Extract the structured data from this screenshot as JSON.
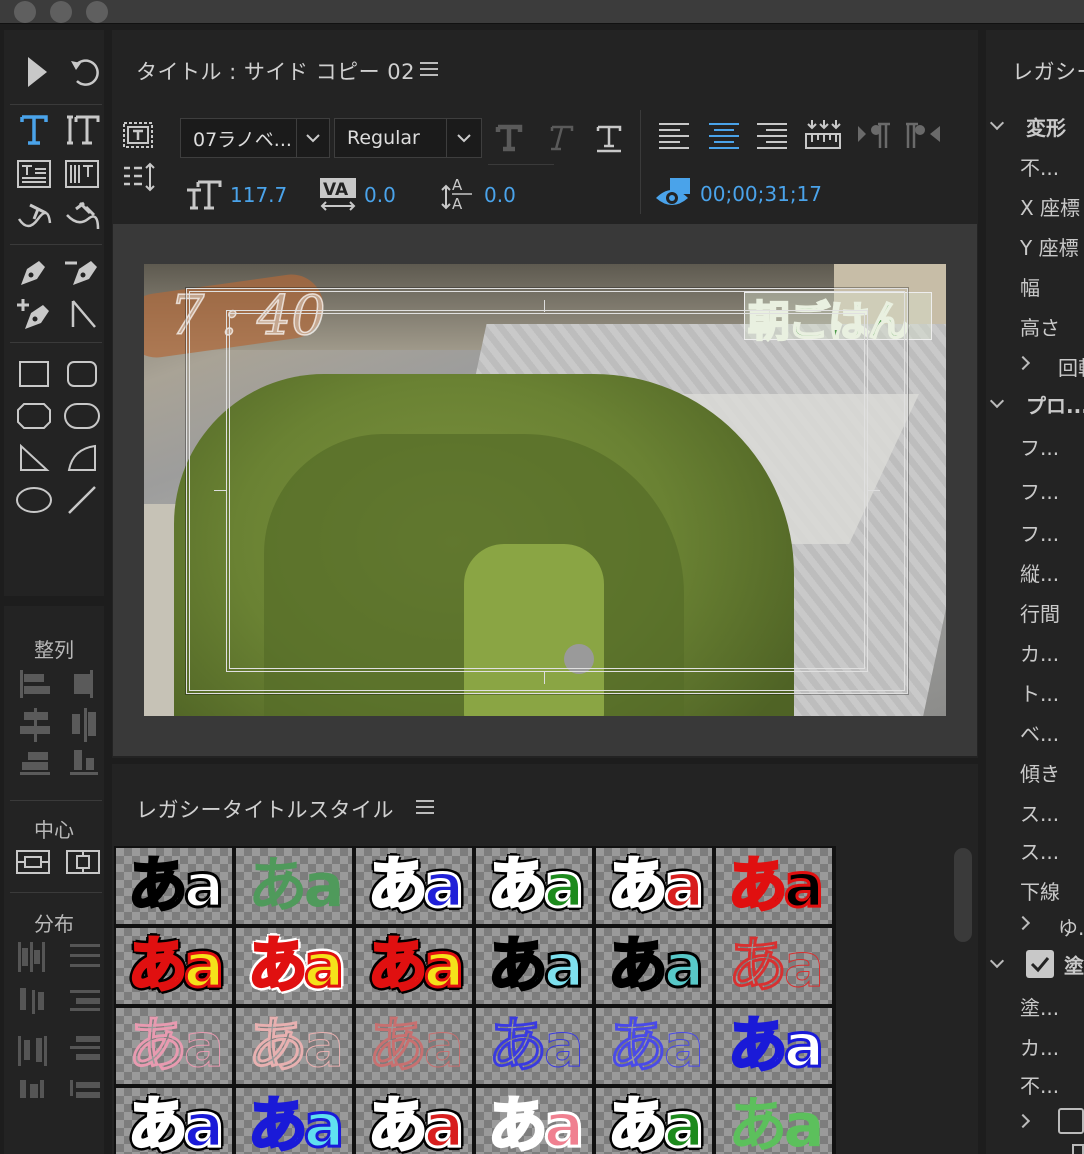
{
  "colors": {
    "accent": "#4aa3ea",
    "panel": "#232323",
    "background": "#1d1d1d"
  },
  "tools_panel": {
    "align_label": "整列",
    "center_label": "中心",
    "distribute_label": "分布",
    "tools": [
      "selection-tool",
      "rotate-tool",
      "type-tool",
      "vertical-type-tool",
      "area-type-tool",
      "vertical-area-type-tool",
      "path-type-tool",
      "vertical-path-type-tool",
      "pen-tool",
      "delete-anchor-tool",
      "add-anchor-tool",
      "convert-anchor-tool",
      "rectangle-tool",
      "rounded-rect-tool",
      "clipped-rect-tool",
      "rounded-corner-tool",
      "wedge-tool",
      "arc-tool",
      "ellipse-tool",
      "line-tool"
    ]
  },
  "title_panel": {
    "title": "タイトル : サイド コピー 02",
    "font_family": "07ラノベ...",
    "font_style": "Regular",
    "font_size": "117.7",
    "kerning": "0.0",
    "leading": "0.0",
    "timecode": "00;00;31;17"
  },
  "video": {
    "time_text": "7 : 40",
    "caption_text": "朝ごはん"
  },
  "styles_panel": {
    "title": "レガシータイトルスタイル",
    "swatches": [
      {
        "text": "あa",
        "fg": "#ffffff",
        "stroke": "#000000",
        "outer": "",
        "bg": "checker"
      },
      {
        "text": "あa",
        "fg": "#4f9a5b",
        "stroke": "",
        "outer": "",
        "bg": "checker"
      },
      {
        "text": "あa",
        "fg": "#2020d8",
        "stroke": "#ffffff",
        "outer": "#000000",
        "bg": "checker"
      },
      {
        "text": "あa",
        "fg": "#1c8a1c",
        "stroke": "#ffffff",
        "outer": "#000000",
        "bg": "checker"
      },
      {
        "text": "あa",
        "fg": "#d81e1e",
        "stroke": "#ffffff",
        "outer": "#000000",
        "bg": "checker"
      },
      {
        "text": "あa",
        "fg": "#000000",
        "stroke": "#e01010",
        "outer": "",
        "bg": "checker"
      },
      {
        "text": "あa",
        "fg": "#f5e21a",
        "stroke": "#e01010",
        "outer": "#000000",
        "bg": "checker"
      },
      {
        "text": "あa",
        "fg": "#f5e21a",
        "stroke": "#e01010",
        "outer": "#ffffff",
        "bg": "checker"
      },
      {
        "text": "あa",
        "fg": "#f5e21a",
        "stroke": "#e01010",
        "outer": "#000000",
        "bg": "checker"
      },
      {
        "text": "あa",
        "fg": "#7ee0ee",
        "stroke": "#000000",
        "outer": "",
        "bg": "checker"
      },
      {
        "text": "あa",
        "fg": "#58c8c8",
        "stroke": "#000000",
        "outer": "",
        "bg": "checker"
      },
      {
        "text": "あa",
        "fg": "transparent",
        "stroke": "#d83030",
        "outer": "",
        "bg": "checker"
      },
      {
        "text": "あa",
        "fg": "transparent",
        "stroke": "#e89ab0",
        "outer": "",
        "bg": "checker"
      },
      {
        "text": "あa",
        "fg": "transparent",
        "stroke": "#e8b0b0",
        "outer": "",
        "bg": "checker"
      },
      {
        "text": "あa",
        "fg": "transparent",
        "stroke": "#c87070",
        "outer": "",
        "bg": "checker"
      },
      {
        "text": "あa",
        "fg": "transparent",
        "stroke": "#3a3ae0",
        "outer": "",
        "bg": "checker"
      },
      {
        "text": "あa",
        "fg": "transparent",
        "stroke": "#4a4ae8",
        "outer": "",
        "bg": "checker"
      },
      {
        "text": "あa",
        "fg": "#ffffff",
        "stroke": "#1a1ad8",
        "outer": "",
        "bg": "checker"
      },
      {
        "text": "あa",
        "fg": "#1a1ad8",
        "stroke": "#ffffff",
        "outer": "#000000",
        "bg": "checker"
      },
      {
        "text": "あa",
        "fg": "#60e0f0",
        "stroke": "#1a1ad8",
        "outer": "",
        "bg": "checker"
      },
      {
        "text": "あa",
        "fg": "#d81e1e",
        "stroke": "#ffffff",
        "outer": "#000000",
        "bg": "checker"
      },
      {
        "text": "あa",
        "fg": "#f08090",
        "stroke": "#ffffff",
        "outer": "",
        "bg": "checker"
      },
      {
        "text": "あa",
        "fg": "#1c8a1c",
        "stroke": "#ffffff",
        "outer": "#000000",
        "bg": "checker"
      },
      {
        "text": "あa",
        "fg": "#5cc05c",
        "stroke": "",
        "outer": "",
        "bg": "checker"
      }
    ]
  },
  "properties_panel": {
    "title": "レガシー",
    "section_transform": "変形",
    "opacity": "不...",
    "x_pos": "X 座標",
    "y_pos": "Y 座標",
    "width": "幅",
    "height": "高さ",
    "rotation": "回転",
    "section_properties": "プロ...",
    "font_family": "フ...",
    "font_style": "フ...",
    "font_size": "フ...",
    "aspect": "縦...",
    "leading": "行間",
    "kerning": "カ...",
    "tracking": "ト...",
    "baseline": "ベ...",
    "slant": "傾き",
    "small_caps": "ス...",
    "small_caps_size": "ス...",
    "underline": "下線",
    "distort": "ゆ...",
    "section_fill": "塗",
    "fill_type": "塗...",
    "fill_color": "カ...",
    "fill_opacity": "不..."
  }
}
